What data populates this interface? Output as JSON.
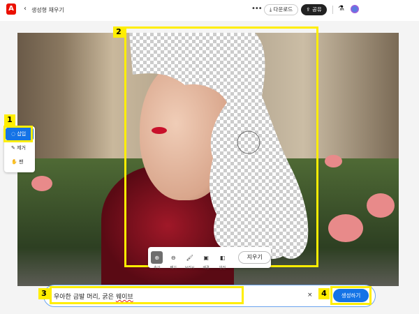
{
  "header": {
    "logo": "A",
    "title": "생성형 채우기",
    "download": "다운로드",
    "share": "공유",
    "more": "•••"
  },
  "sidebar": {
    "items": [
      {
        "label": "삽입",
        "icon": "insert-icon"
      },
      {
        "label": "제거",
        "icon": "remove-icon"
      },
      {
        "label": "팬",
        "icon": "hand-icon"
      }
    ]
  },
  "toolbar": {
    "tools": [
      {
        "label": "추가",
        "icon": "add-icon"
      },
      {
        "label": "빼기",
        "icon": "subtract-icon"
      },
      {
        "label": "브러시",
        "icon": "brush-icon"
      },
      {
        "label": "배경",
        "icon": "background-icon"
      },
      {
        "label": "반전",
        "icon": "invert-icon"
      }
    ],
    "erase": "지우기"
  },
  "prompt": {
    "value_plain": "우아한 금발 머리, 굵은 ",
    "value_misspelled": "웨이브",
    "clear": "×",
    "generate": "생성하기"
  },
  "annotations": [
    "1",
    "2",
    "3",
    "4"
  ],
  "colors": {
    "accent": "#1473e6",
    "highlight": "#ffee00"
  }
}
